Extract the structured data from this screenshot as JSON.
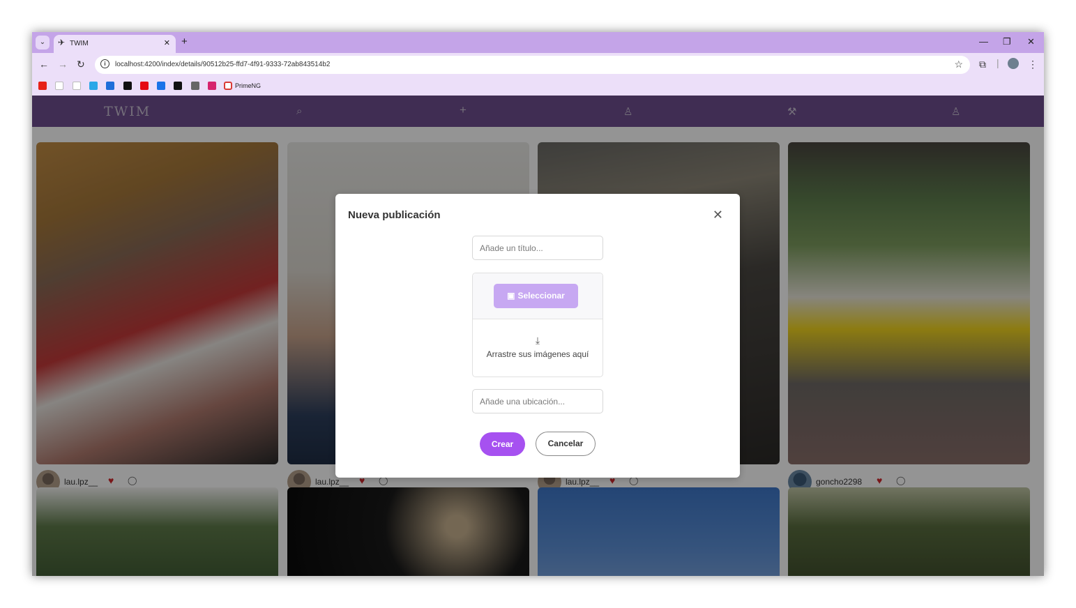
{
  "browser": {
    "tab_title": "TWIM",
    "url": "localhost:4200/index/details/90512b25-ffd7-4f91-9333-72ab843514b2",
    "bookmarks": [
      {
        "name": "youtube-bookmark",
        "color": "#e62117"
      },
      {
        "name": "amazon-bookmark",
        "color": "#ffffff"
      },
      {
        "name": "github-bookmark",
        "color": "#ffffff"
      },
      {
        "name": "edge-bookmark",
        "color": "#2aa7e8"
      },
      {
        "name": "education-bookmark",
        "color": "#1e6fd9"
      },
      {
        "name": "circle-bookmark",
        "color": "#111111"
      },
      {
        "name": "netflix-bookmark",
        "color": "#e50914"
      },
      {
        "name": "play-bookmark",
        "color": "#1a73e8"
      },
      {
        "name": "s-bookmark",
        "color": "#111111"
      },
      {
        "name": "chatgpt-bookmark",
        "color": "#666666"
      },
      {
        "name": "d-bookmark",
        "color": "#d6236e"
      }
    ],
    "bookmark_label": "PrimeNG"
  },
  "app": {
    "logo": "TWIM"
  },
  "posts_row1": [
    {
      "username": "lau.lpz__"
    },
    {
      "username": "lau.lpz__"
    },
    {
      "username": "lau.lpz__"
    },
    {
      "username": "goncho2298"
    }
  ],
  "dialog": {
    "title": "Nueva publicación",
    "title_placeholder": "Añade un título...",
    "select_label": "Seleccionar",
    "drop_text": "Arrastre sus imágenes aquí",
    "location_placeholder": "Añade una ubicación...",
    "create_label": "Crear",
    "cancel_label": "Cancelar"
  }
}
